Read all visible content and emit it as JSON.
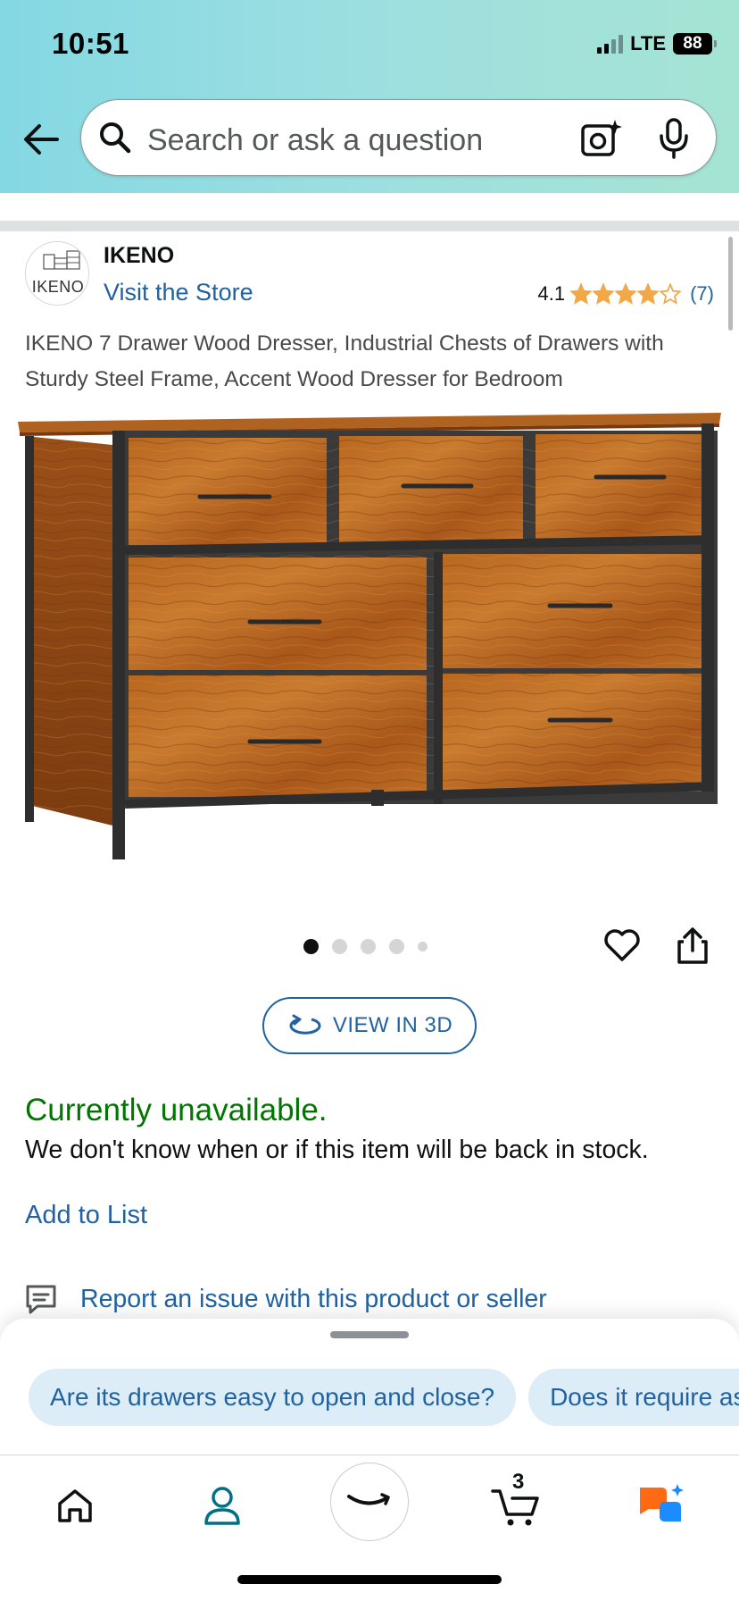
{
  "status_bar": {
    "time": "10:51",
    "network": "LTE",
    "battery": "88"
  },
  "search": {
    "placeholder": "Search or ask a question"
  },
  "brand": {
    "logo_text": "IKENO",
    "name": "IKENO",
    "visit_store": "Visit the Store"
  },
  "rating": {
    "value": "4.1",
    "count": "(7)",
    "stars": 4.1,
    "star_color": "#f3a847"
  },
  "product": {
    "title": "IKENO 7 Drawer Wood Dresser, Industrial Chests of Drawers with Sturdy Steel Frame, Accent Wood Dresser for Bedroom",
    "image_icon": "dresser-image",
    "image_count": 5,
    "active_image": 1
  },
  "actions": {
    "view_3d": "VIEW IN 3D",
    "favorite_icon": "heart-icon",
    "share_icon": "share-icon"
  },
  "availability": {
    "status": "Currently unavailable.",
    "message": "We don't know when or if this item will be back in stock.",
    "status_color": "#007600"
  },
  "add_to_list": "Add to List",
  "report": {
    "text": "Report an issue with this product or seller",
    "icon": "report-icon"
  },
  "suggestions": [
    "Are its drawers easy to open and close?",
    "Does it require assembly?"
  ],
  "bottom_nav": {
    "items": [
      "home-icon",
      "profile-icon",
      "amazon-smile-icon",
      "cart-icon",
      "rufus-icon"
    ],
    "cart_count": "3"
  },
  "colors": {
    "link": "#2162a1",
    "chip_bg": "#dcedf7",
    "header_gradient": [
      "#84d8e3",
      "#a5e4d3"
    ]
  }
}
